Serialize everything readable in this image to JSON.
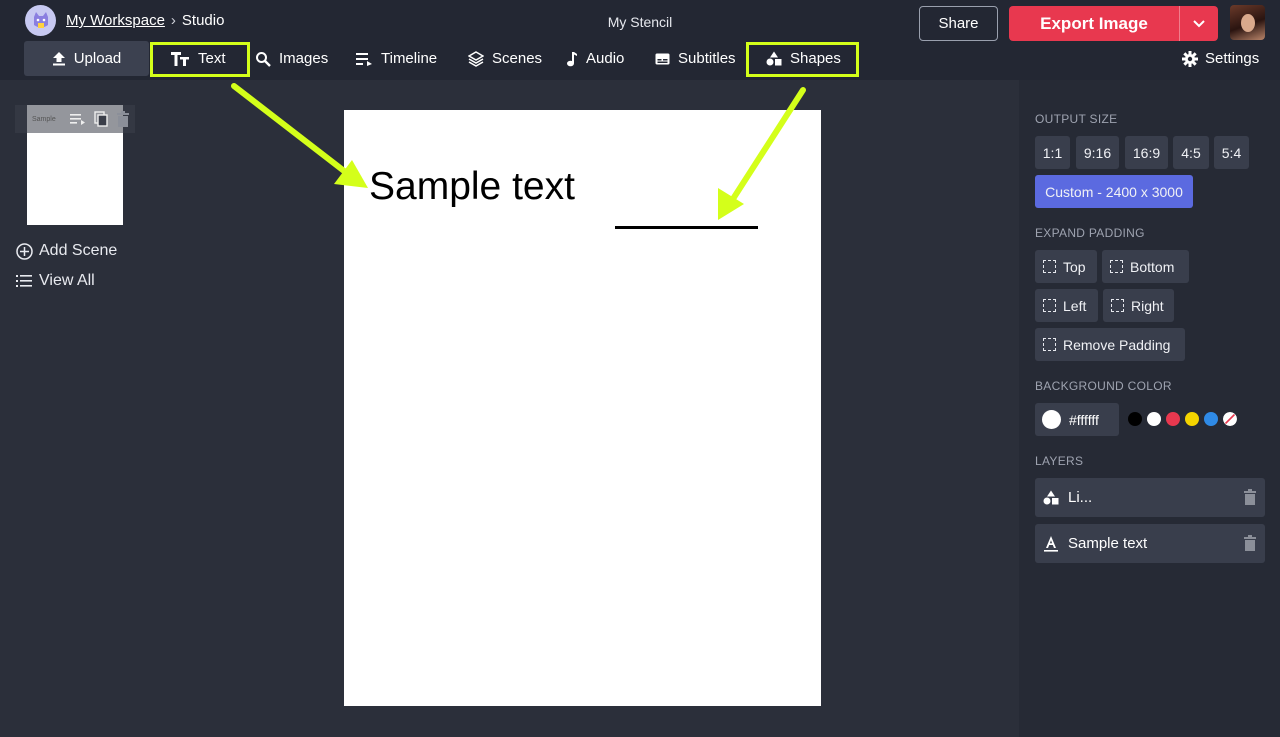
{
  "header": {
    "workspace_link": "My Workspace",
    "separator": "›",
    "current_page": "Studio",
    "document_title": "My Stencil",
    "share_label": "Share",
    "export_label": "Export Image"
  },
  "toolbar": {
    "tools": [
      {
        "label": "Upload",
        "icon": "upload-icon"
      },
      {
        "label": "Text",
        "icon": "text-icon",
        "highlighted": true
      },
      {
        "label": "Images",
        "icon": "search-icon"
      },
      {
        "label": "Timeline",
        "icon": "timeline-icon"
      },
      {
        "label": "Scenes",
        "icon": "layers-icon"
      },
      {
        "label": "Audio",
        "icon": "music-note-icon"
      },
      {
        "label": "Subtitles",
        "icon": "subtitles-icon"
      },
      {
        "label": "Shapes",
        "icon": "shapes-icon",
        "highlighted": true
      }
    ],
    "settings_label": "Settings"
  },
  "left_panel": {
    "thumb_text": "Sample",
    "add_scene_label": "Add Scene",
    "view_all_label": "View All"
  },
  "canvas": {
    "text": "Sample text",
    "background": "#ffffff"
  },
  "right_panel": {
    "output_size_label": "OUTPUT SIZE",
    "sizes": [
      "1:1",
      "9:16",
      "16:9",
      "4:5",
      "5:4"
    ],
    "custom_size": "Custom - 2400 x 3000",
    "expand_padding_label": "EXPAND PADDING",
    "padding": {
      "top": "Top",
      "bottom": "Bottom",
      "left": "Left",
      "right": "Right",
      "remove": "Remove Padding"
    },
    "background_color_label": "BACKGROUND COLOR",
    "background_color_value": "#ffffff",
    "color_swatches": [
      "#000000",
      "#ffffff",
      "#e8384f",
      "#f4d400",
      "#2f8ae6",
      "none"
    ],
    "layers_label": "LAYERS",
    "layers": [
      {
        "name": "Li...",
        "icon": "shapes-icon"
      },
      {
        "name": "Sample text",
        "icon": "text-a-icon"
      }
    ]
  },
  "colors": {
    "accent_export": "#e8384f",
    "highlight": "#d4ff1a",
    "active_chip": "#5b6ae0"
  }
}
